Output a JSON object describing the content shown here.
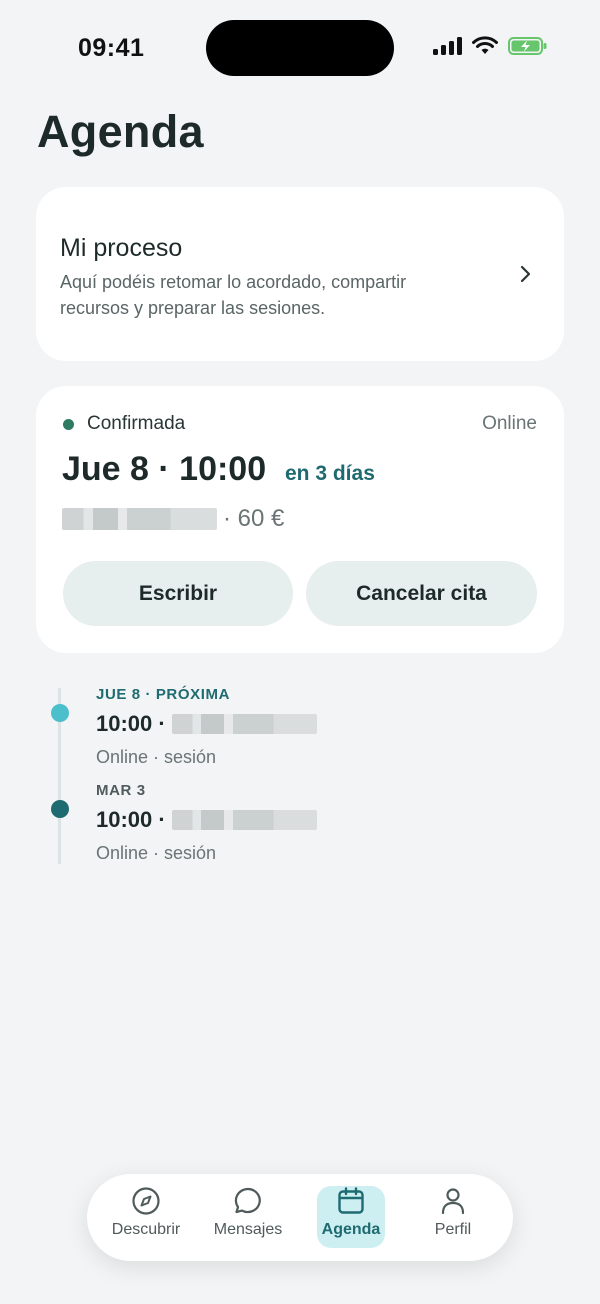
{
  "status_bar": {
    "time": "09:41"
  },
  "page": {
    "title": "Agenda"
  },
  "process_card": {
    "title": "Mi proceso",
    "description": "Aquí podéis retomar lo acordado, compartir recursos y preparar las sesiones."
  },
  "appointment": {
    "status": "Confirmada",
    "status_color": "#2f7a63",
    "mode": "Online",
    "datetime": "Jue 8 · 10:00",
    "relative": "en 3 días",
    "price": "· 60 €",
    "buttons": {
      "write": "Escribir",
      "cancel": "Cancelar cita"
    }
  },
  "timeline": [
    {
      "date": "JUE 8 · PRÓXIMA",
      "time": "10:00 ·",
      "meta": "Online · sesión",
      "dot_color": "#4cbfcc"
    },
    {
      "date": "MAR 3",
      "time": "10:00 ·",
      "meta": "Online · sesión",
      "dot_color": "#1f6b72"
    }
  ],
  "nav": {
    "items": [
      {
        "label": "Descubrir",
        "icon": "compass-icon"
      },
      {
        "label": "Mensajes",
        "icon": "chat-bubble-icon"
      },
      {
        "label": "Agenda",
        "icon": "calendar-icon",
        "active": true
      },
      {
        "label": "Perfil",
        "icon": "person-icon"
      }
    ]
  },
  "colors": {
    "accent": "#1f6b72",
    "background": "#f2f4f5",
    "active_nav_bg": "#cdeff2",
    "button_bg": "#e7eeee"
  }
}
